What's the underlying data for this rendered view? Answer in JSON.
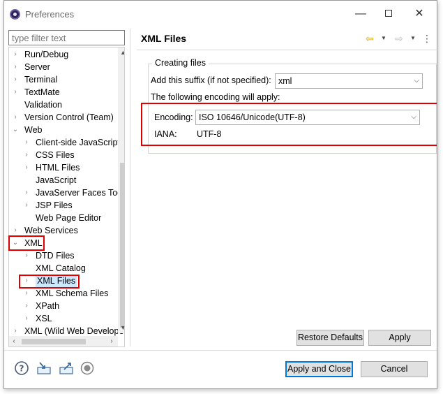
{
  "window": {
    "title": "Preferences",
    "minimize_glyph": "—",
    "close_glyph": "✕"
  },
  "filter": {
    "placeholder": "type filter text"
  },
  "tree": {
    "items": [
      {
        "label": "Run/Debug",
        "twisty": "›",
        "level": 0
      },
      {
        "label": "Server",
        "twisty": "›",
        "level": 0
      },
      {
        "label": "Terminal",
        "twisty": "›",
        "level": 0
      },
      {
        "label": "TextMate",
        "twisty": "›",
        "level": 0
      },
      {
        "label": "Validation",
        "twisty": "",
        "level": 0
      },
      {
        "label": "Version Control (Team)",
        "twisty": "›",
        "level": 0
      },
      {
        "label": "Web",
        "twisty": "⌄",
        "level": 0
      },
      {
        "label": "Client-side JavaScript",
        "twisty": "›",
        "level": 1
      },
      {
        "label": "CSS Files",
        "twisty": "›",
        "level": 1
      },
      {
        "label": "HTML Files",
        "twisty": "›",
        "level": 1
      },
      {
        "label": "JavaScript",
        "twisty": "",
        "level": 1
      },
      {
        "label": "JavaServer Faces Tools",
        "twisty": "›",
        "level": 1
      },
      {
        "label": "JSP Files",
        "twisty": "›",
        "level": 1
      },
      {
        "label": "Web Page Editor",
        "twisty": "",
        "level": 1
      },
      {
        "label": "Web Services",
        "twisty": "›",
        "level": 0
      },
      {
        "label": "XML",
        "twisty": "⌄",
        "level": 0
      },
      {
        "label": "DTD Files",
        "twisty": "›",
        "level": 1
      },
      {
        "label": "XML Catalog",
        "twisty": "",
        "level": 1
      },
      {
        "label": "XML Files",
        "twisty": "›",
        "level": 1,
        "selected": true
      },
      {
        "label": "XML Schema Files",
        "twisty": "›",
        "level": 1
      },
      {
        "label": "XPath",
        "twisty": "›",
        "level": 1
      },
      {
        "label": "XSL",
        "twisty": "›",
        "level": 1
      },
      {
        "label": "XML (Wild Web Developer)",
        "twisty": "›",
        "level": 0
      }
    ],
    "scroll_up": "▲",
    "scroll_down": "▼",
    "scroll_left": "‹",
    "scroll_right": "›"
  },
  "page": {
    "title": "XML Files",
    "nav_back_glyph": "⇦",
    "nav_forward_glyph": "⇨",
    "dropdown_glyph": "▼",
    "menu_glyph": "⋮",
    "group_title": "Creating files",
    "suffix_label": "Add this suffix (if not specified):",
    "suffix_value": "xml",
    "encoding_note": "The following encoding will apply:",
    "encoding_label": "Encoding:",
    "encoding_value": "ISO 10646/Unicode(UTF-8)",
    "iana_label": "IANA:",
    "iana_value": "UTF-8",
    "combo_arrow": "⌵"
  },
  "buttons": {
    "restore_defaults": "Restore Defaults",
    "apply": "Apply",
    "apply_and_close": "Apply and Close",
    "cancel": "Cancel"
  },
  "colors": {
    "highlight": "#e00000",
    "primary_border": "#0078d7",
    "selection": "#cce8ff"
  }
}
